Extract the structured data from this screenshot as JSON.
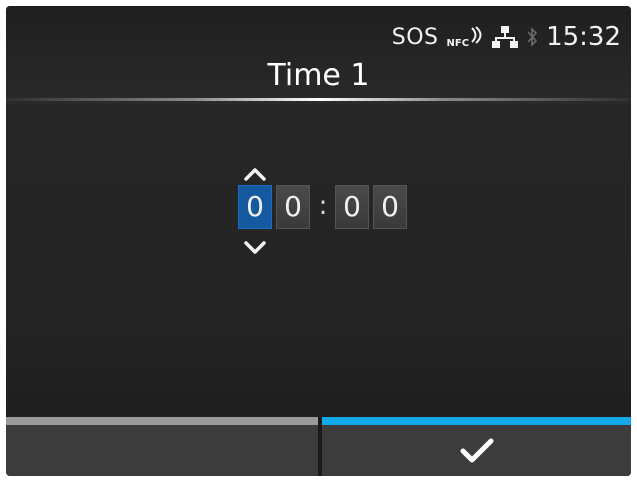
{
  "status_bar": {
    "sos_label": "SOS",
    "nfc_label": "NFC",
    "time": "15:32",
    "icons": [
      "nfc-signal-icon",
      "network-icon",
      "bluetooth-icon"
    ]
  },
  "header": {
    "title": "Time 1"
  },
  "time_editor": {
    "digits": [
      "0",
      "0",
      "0",
      "0"
    ],
    "separator": ":",
    "selected_digit_index": 0
  },
  "softkeys": {
    "left": {
      "label": ""
    },
    "right": {
      "icon": "checkmark-icon"
    }
  },
  "colors": {
    "screen_bg": "#262626",
    "selected_digit": "#155aa0",
    "accent_bar": "#13a8e8",
    "inactive_bar": "#9a9a9a"
  }
}
